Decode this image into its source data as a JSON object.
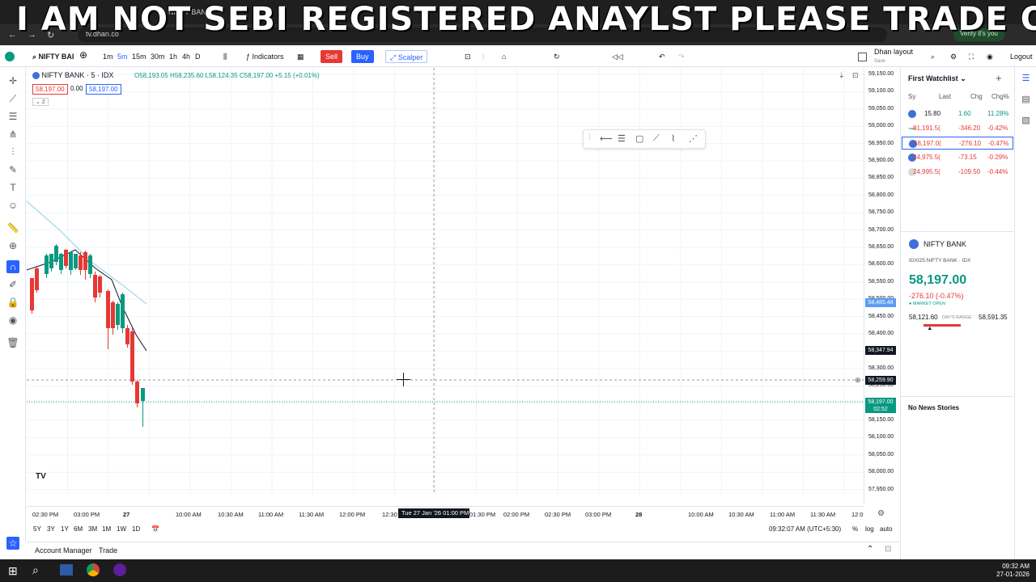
{
  "overlay_text": "I AM NOT SEBI REGISTERED ANAYLST  PLEASE TRADE ON YO",
  "browser": {
    "url": "tv.dhan.co",
    "verify_label": "Verify it's you",
    "tab_label": "NIFTY BANK"
  },
  "toolbar": {
    "symbol": "NIFTY BAI",
    "intervals": [
      "1m",
      "5m",
      "15m",
      "30m",
      "1h",
      "4h",
      "D"
    ],
    "indicators_label": "Indicators",
    "sell_label": "Sell",
    "buy_label": "Buy",
    "scalper_label": "Scalper",
    "layout_label": "Dhan layout",
    "layout_sub": "Save",
    "logout_label": "Logout"
  },
  "legend": {
    "title": "NIFTY BANK · 5 · IDX",
    "ohlc": "O58,193.05 H58,235.60 L58,124.35 C58,197.00 +5.15 (+0.01%)",
    "sell_price": "58,197.00",
    "spread": "0.00",
    "buy_price": "58,197.00",
    "indicator_count": "2"
  },
  "price_scale": {
    "ticks": [
      "59,150.00",
      "59,100.00",
      "59,050.00",
      "59,000.00",
      "58,950.00",
      "58,900.00",
      "58,850.00",
      "58,800.00",
      "58,750.00",
      "58,700.00",
      "58,650.00",
      "58,600.00",
      "58,550.00",
      "58,500.00",
      "58,450.00",
      "58,400.00",
      "58,350.00",
      "58,300.00",
      "58,250.00",
      "58,200.00",
      "58,150.00",
      "58,100.00",
      "58,050.00",
      "58,000.00",
      "57,950.00"
    ],
    "label_ma": "58,485.48",
    "label_high": "58,347.94",
    "label_cursor": "58,259.90",
    "label_last": "58,197.00",
    "label_countdown": "02:52"
  },
  "time_scale": {
    "ticks": [
      "02:30 PM",
      "03:00 PM",
      "27",
      "10:00 AM",
      "10:30 AM",
      "11:00 AM",
      "11:30 AM",
      "12:00 PM",
      "12:30",
      "01:30 PM",
      "02:00 PM",
      "02:30 PM",
      "03:00 PM",
      "28",
      "10:00 AM",
      "10:30 AM",
      "11:00 AM",
      "11:30 AM",
      "12:0"
    ],
    "cursor_label": "Tue 27 Jan '26   01:00 PM"
  },
  "bottom": {
    "ranges": [
      "5Y",
      "3Y",
      "1Y",
      "6M",
      "3M",
      "1M",
      "1W",
      "1D"
    ],
    "clock": "09:32:07 AM (UTC+5:30)",
    "percent": "%",
    "log": "log",
    "auto": "auto"
  },
  "account_bar": {
    "account_manager": "Account Manager",
    "trade": "Trade"
  },
  "watchlist": {
    "title": "First Watchlist",
    "columns": [
      "Sy",
      "Last",
      "Chg",
      "Chg%"
    ],
    "rows": [
      {
        "last": "15.80",
        "chg": "1.60",
        "chgp": "11.28%",
        "dir": "pos"
      },
      {
        "last": "81,191.5(",
        "chg": "-346.20",
        "chgp": "-0.42%",
        "dir": "neg"
      },
      {
        "last": "58,197.0(",
        "chg": "-276.10",
        "chgp": "-0.47%",
        "dir": "neg"
      },
      {
        "last": "24,975.5(",
        "chg": "-73.15",
        "chgp": "-0.29%",
        "dir": "neg"
      },
      {
        "last": "24,995.5(",
        "chg": "-109.50",
        "chgp": "-0.44%",
        "dir": "neg"
      }
    ]
  },
  "quote": {
    "name": "NIFTY BANK",
    "exchange": "IDXI25:NIFTY BANK · IDX",
    "price": "58,197.00",
    "change": "-276.10 (-0.47%)",
    "status": "MARKET OPEN",
    "day_low": "58,121.60",
    "day_range_label": "DAY'S RANGE",
    "day_high": "58,591.35",
    "range_fraction": 0.16
  },
  "news": {
    "label": "No News Stories"
  },
  "taskbar": {
    "time": "09:32 AM",
    "date": "27-01-2026"
  },
  "colors": {
    "up": "#089981",
    "down": "#e53935",
    "accent": "#2962ff"
  }
}
